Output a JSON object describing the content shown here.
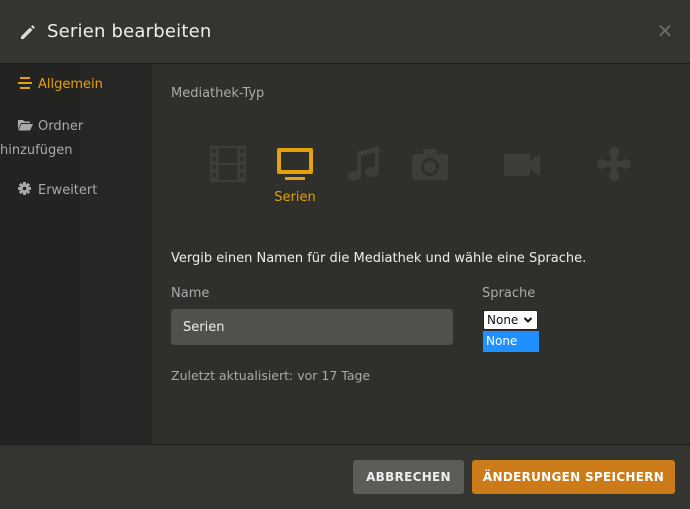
{
  "header": {
    "title": "Serien bearbeiten",
    "close_glyph": "×"
  },
  "sidebar": {
    "items": [
      {
        "label": "Allgemein",
        "icon": "list-icon",
        "active": true
      },
      {
        "label": "Ordner",
        "label2": "hinzufügen",
        "icon": "folder-open-icon",
        "active": false
      },
      {
        "label": "Erweitert",
        "icon": "gear-icon",
        "active": false
      }
    ]
  },
  "main": {
    "library_type_label": "Mediathek-Typ",
    "types": [
      {
        "icon": "film-icon",
        "label": "",
        "active": false
      },
      {
        "icon": "tv-icon",
        "label": "Serien",
        "active": true
      },
      {
        "icon": "music-icon",
        "label": "",
        "active": false
      },
      {
        "icon": "camera-icon",
        "label": "",
        "active": false
      },
      {
        "icon": "video-camera-icon",
        "label": "",
        "active": false
      },
      {
        "icon": "gamepad-icon",
        "label": "",
        "active": false
      }
    ],
    "prompt": "Vergib einen Namen für die Mediathek und wähle eine Sprache.",
    "name_label": "Name",
    "name_value": "Serien",
    "language_label": "Sprache",
    "language_selected": "None",
    "language_options": [
      "None"
    ],
    "last_updated": "Zuletzt aktualisiert: vor 17 Tage"
  },
  "footer": {
    "cancel_label": "ABBRECHEN",
    "save_label": "ÄNDERUNGEN SPEICHERN"
  },
  "colors": {
    "accent": "#e5a00d",
    "save_button": "#cc7b19",
    "cancel_button": "#5c5c58",
    "option_highlight": "#1e90ff"
  }
}
